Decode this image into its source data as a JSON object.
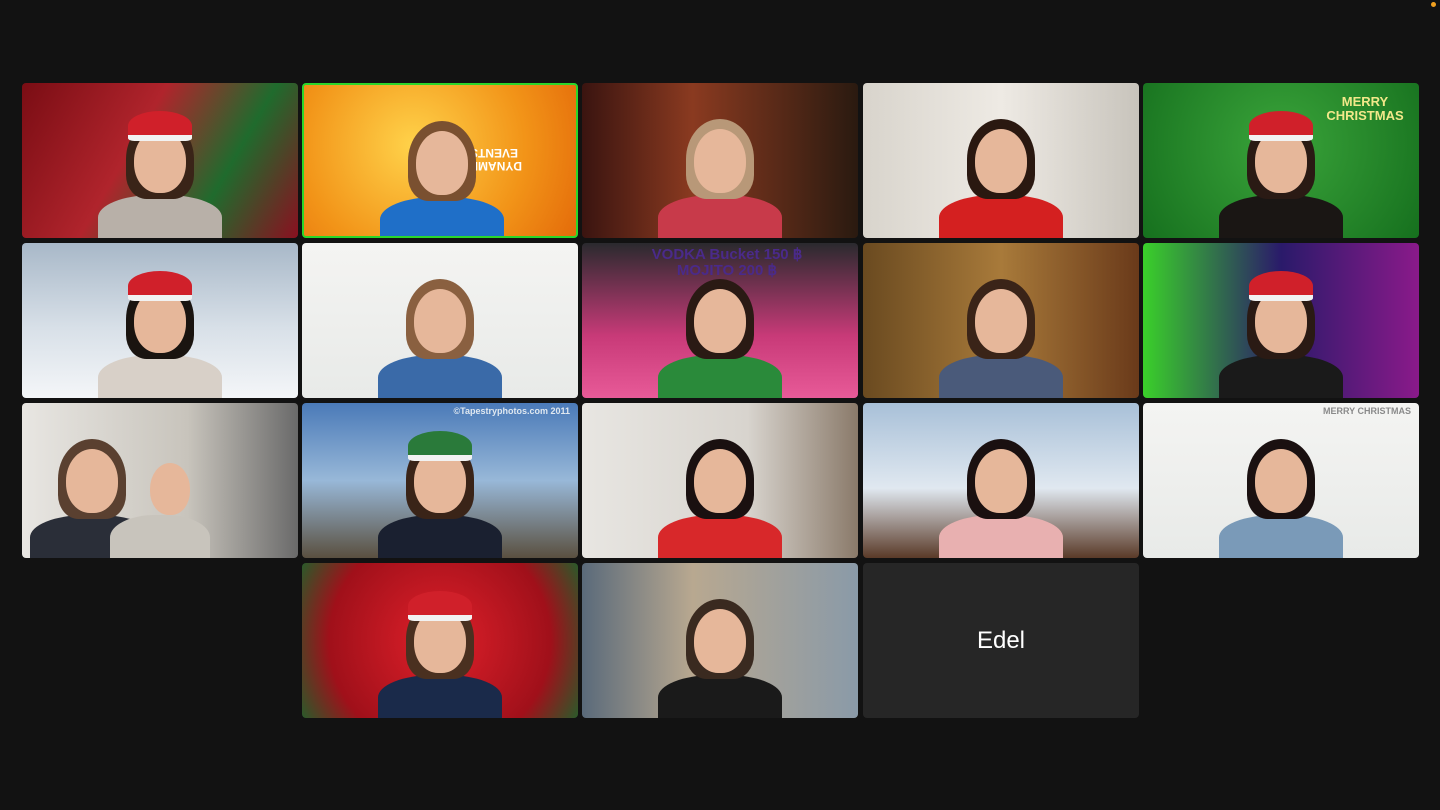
{
  "indicator_color": "#f0a020",
  "active_speaker_color": "#2bd62b",
  "tiles": [
    {
      "bg": "linear-gradient(120deg,#7a0d14,#b0242c 40%,#1f6b2d 70%,#8a1020)",
      "shirt": "#b8b0a8",
      "hair": "#3a2418",
      "hat": true,
      "text": ""
    },
    {
      "bg": "radial-gradient(circle at 40% 40%,#ffd24a,#f29418 60%,#e46b0a)",
      "shirt": "#1f6fc8",
      "hair": "#7a5030",
      "hat": false,
      "active": true,
      "text": "DYNAMIC EVENTS",
      "text_color": "#ffffff"
    },
    {
      "bg": "linear-gradient(90deg,#3a1410,#8a3a20 40%,#5a2a18 70%,#2a1a10)",
      "shirt": "#c83a4a",
      "hair": "#b89878",
      "hat": false,
      "text": ""
    },
    {
      "bg": "linear-gradient(90deg,#d8d4cc,#eeeae4 50%,#c8c4bc)",
      "shirt": "#d42020",
      "hair": "#2a1810",
      "hat": false,
      "text": ""
    },
    {
      "bg": "radial-gradient(circle at 50% 40%,#3aa43a,#16701e)",
      "shirt": "#1a1614",
      "hair": "#2a1a14",
      "hat": true,
      "text": "MERRY CHRISTMAS",
      "text_color": "#f2e88a"
    },
    {
      "bg": "linear-gradient(180deg,#a8b8c8,#d8e0e8 55%,#f4f6f8)",
      "shirt": "#d8d0c8",
      "hair": "#1a1410",
      "hat": true,
      "text": ""
    },
    {
      "bg": "linear-gradient(180deg,#f4f4f2,#e8eae8)",
      "shirt": "#3a6aa8",
      "hair": "#8a6040",
      "hat": false,
      "text": ""
    },
    {
      "bg": "linear-gradient(180deg,#2a2a2e,#c83a78 60%,#e85a98)",
      "shirt": "#2a8a3a",
      "hair": "#2a1a14",
      "hat": false,
      "text": "VODKA Bucket 150 ฿   MOJITO 200 ฿",
      "text_color": "#4a2a8a"
    },
    {
      "bg": "linear-gradient(90deg,#6a4a20,#a87a3a 50%,#6a3a1a)",
      "shirt": "#4a5a7a",
      "hair": "#3a2418",
      "hat": false,
      "text": ""
    },
    {
      "bg": "linear-gradient(90deg,#3ad02a,#2a1a6a 50%,#8a1a8a)",
      "shirt": "#1a1a1a",
      "hair": "#2a1a14",
      "hat": true,
      "text": ""
    },
    {
      "bg": "linear-gradient(90deg,#e8e6e2,#c8c4bc 60%,#6a6a6a)",
      "shirt": "#2a2e38",
      "hair": "#5a4030",
      "hat": false,
      "text": ""
    },
    {
      "bg": "linear-gradient(180deg,#4a7ab8,#98b8d8 50%,#5a5040)",
      "shirt": "#1a2030",
      "hair": "#3a2418",
      "hat": true,
      "hat_color": "#2a7a3a",
      "text": "©Tapestryphotos.com 2011",
      "text_color": "#e0e8f0",
      "small": true
    },
    {
      "bg": "linear-gradient(90deg,#e8e6e2,#d8d4ce 60%,#8a7a6a)",
      "shirt": "#d8282a",
      "hair": "#1a1010",
      "hat": false,
      "text": ""
    },
    {
      "bg": "linear-gradient(180deg,#a8c0d8,#e0e8f0 55%,#5a3a28)",
      "shirt": "#e8b0b0",
      "hair": "#1a1010",
      "hat": false,
      "text": ""
    },
    {
      "bg": "linear-gradient(180deg,#f4f4f2,#e8eae8)",
      "shirt": "#7a9ab8",
      "hair": "#1a1010",
      "hat": false,
      "text": "MERRY CHRISTMAS",
      "text_color": "#8a8a8a",
      "small": true
    },
    {
      "bg": "radial-gradient(circle at 50% 50%,#e0202a,#a0101a 70%,#2a5a2a)",
      "shirt": "#1a2a4a",
      "hair": "#4a3020",
      "hat": true,
      "text": ""
    },
    {
      "bg": "linear-gradient(90deg,#5a6a7a,#b8a890 40%,#8a9aa8)",
      "shirt": "#1a1a1a",
      "hair": "#3a2a20",
      "hat": false,
      "text": ""
    },
    {
      "bg": "#262626",
      "name": "Edel"
    }
  ]
}
